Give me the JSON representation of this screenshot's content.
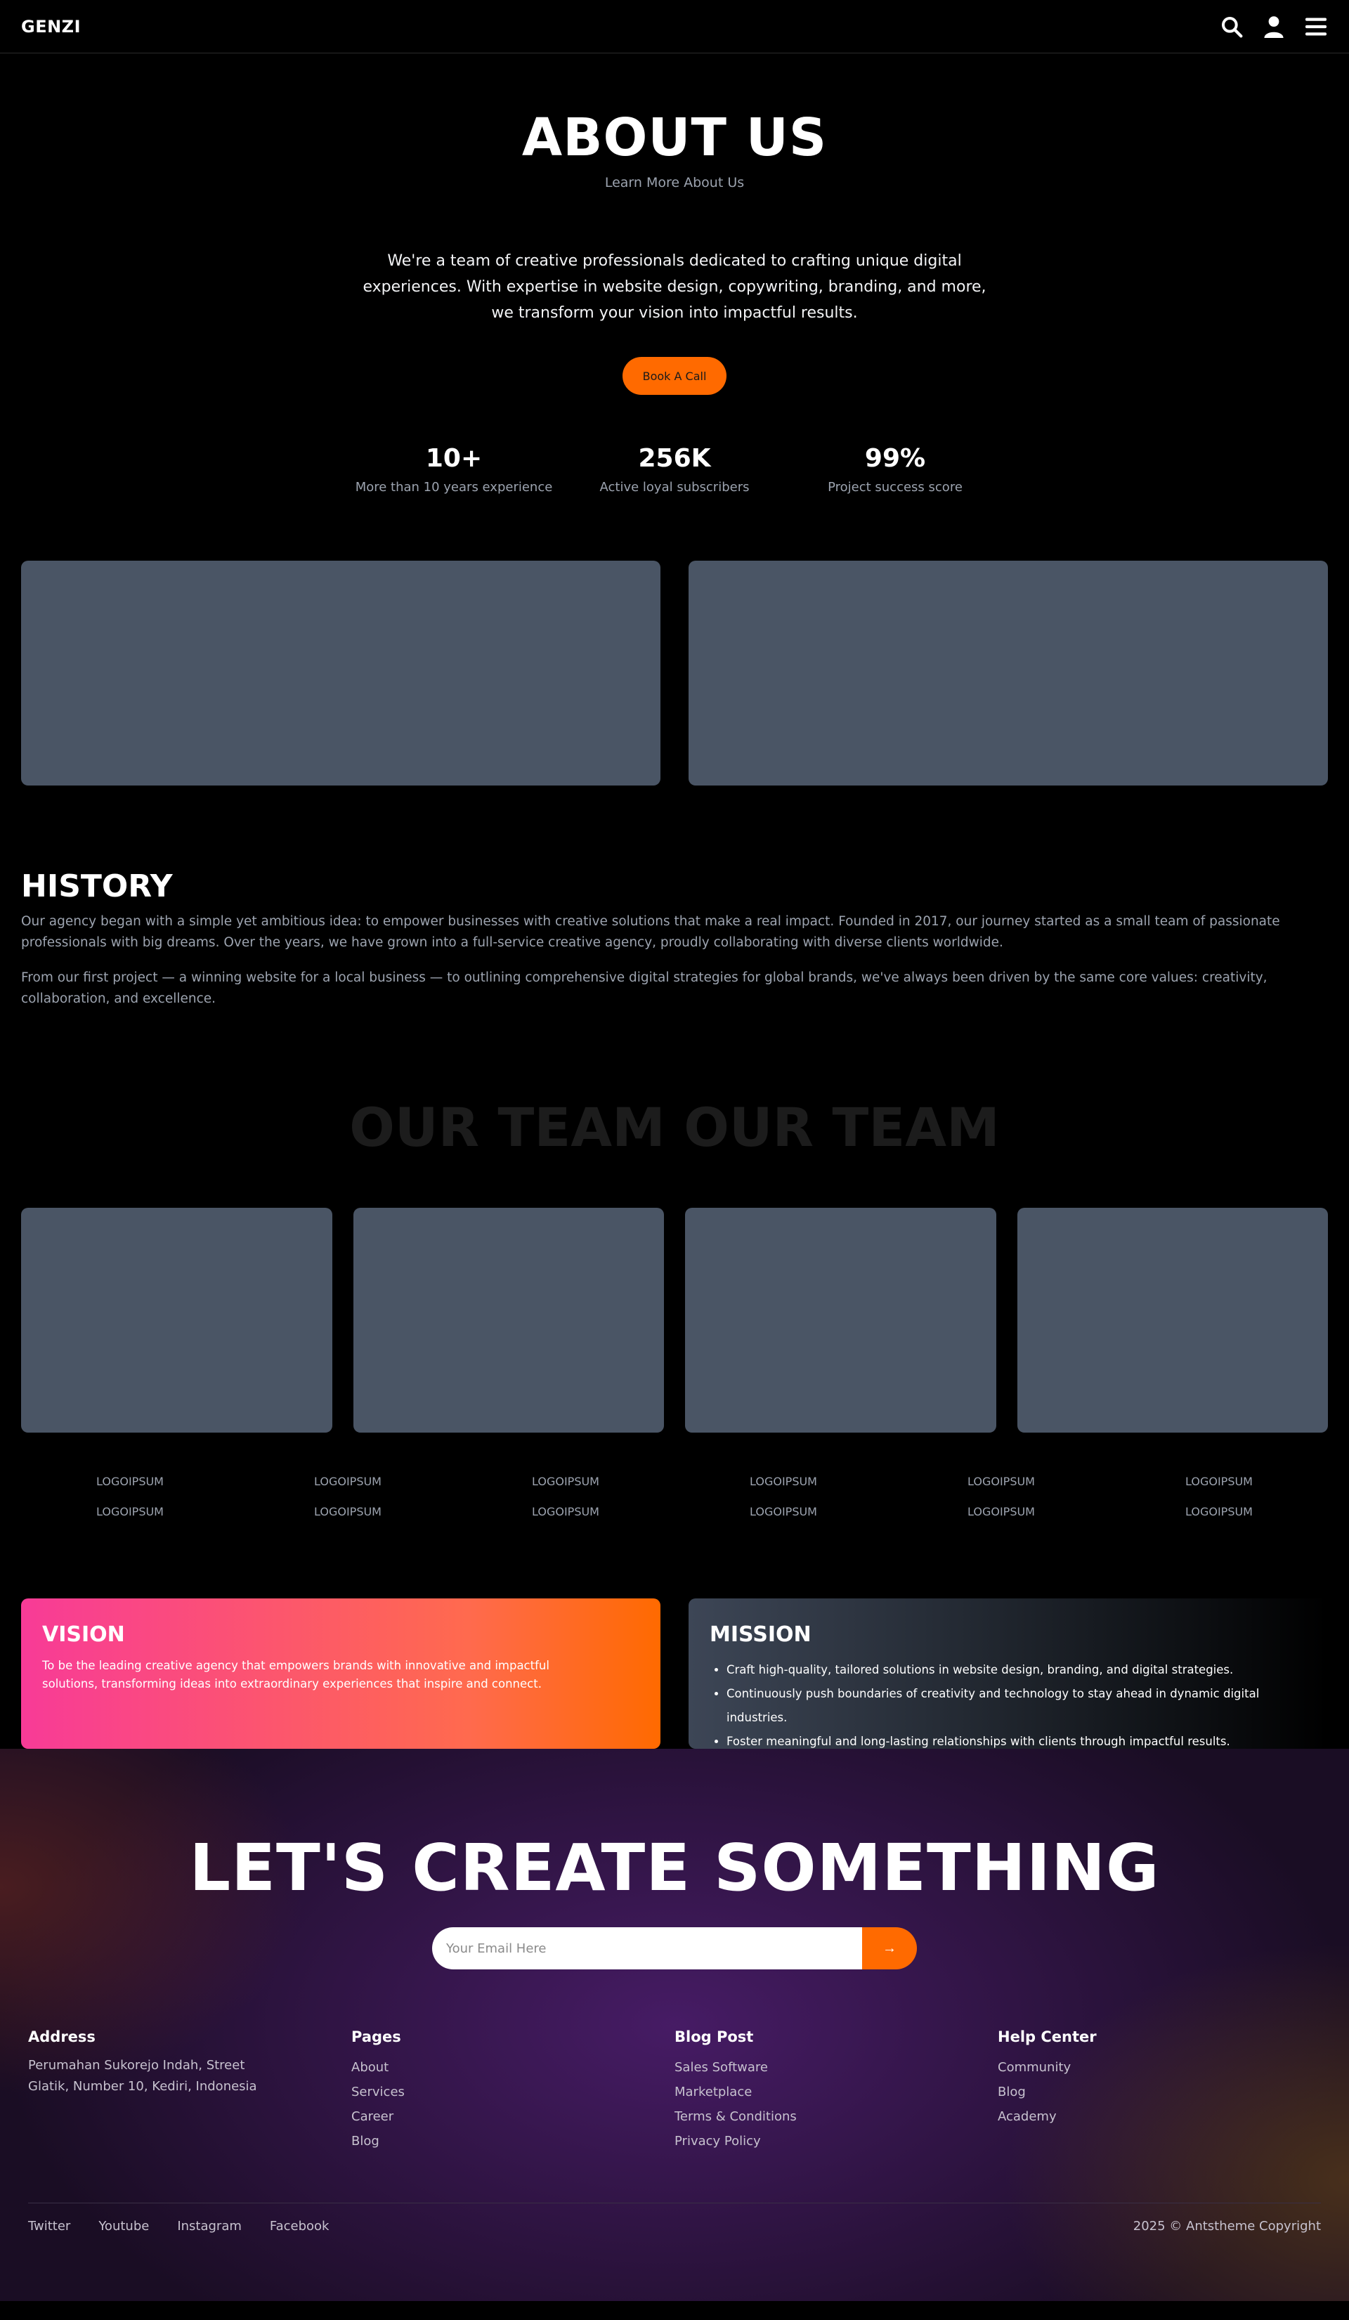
{
  "nav": {
    "logo": "GENZI",
    "icons": [
      "search-icon",
      "user-icon",
      "menu-icon"
    ]
  },
  "hero": {
    "title": "ABOUT US",
    "subtitle": "Learn More About Us",
    "lead": "We're a team of creative professionals dedicated to crafting unique digital experiences. With expertise in website design, copywriting, branding, and more, we transform your vision into impactful results.",
    "cta_label": "Book A Call"
  },
  "stats": [
    {
      "value": "10+",
      "label": "More than 10 years experience"
    },
    {
      "value": "256K",
      "label": "Active loyal subscribers"
    },
    {
      "value": "99%",
      "label": "Project success score"
    }
  ],
  "history": {
    "title": "HISTORY",
    "p1": "Our agency began with a simple yet ambitious idea: to empower businesses with creative solutions that make a real impact. Founded in 2017, our journey started as a small team of passionate professionals with big dreams. Over the years, we have grown into a full-service creative agency, proudly collaborating with diverse clients worldwide.",
    "p2": "From our first project — a winning website for a local business — to outlining comprehensive digital strategies for global brands, we've always been driven by the same core values: creativity, collaboration, and excellence."
  },
  "team": {
    "title": "OUR TEAM OUR TEAM"
  },
  "logos": [
    "LOGOIPSUM",
    "LOGOIPSUM",
    "LOGOIPSUM",
    "LOGOIPSUM",
    "LOGOIPSUM",
    "LOGOIPSUM",
    "LOGOIPSUM",
    "LOGOIPSUM",
    "LOGOIPSUM",
    "LOGOIPSUM",
    "LOGOIPSUM",
    "LOGOIPSUM"
  ],
  "vision": {
    "title": "VISION",
    "text": "To be the leading creative agency that empowers brands with innovative and impactful solutions, transforming ideas into extraordinary experiences that inspire and connect."
  },
  "mission": {
    "title": "MISSION",
    "items": [
      "Craft high-quality, tailored solutions in website design, branding, and digital strategies.",
      "Continuously push boundaries of creativity and technology to stay ahead in dynamic digital industries.",
      "Foster meaningful and long-lasting relationships with clients through impactful results."
    ]
  },
  "footer": {
    "cta": "LET'S CREATE SOMETHING",
    "email_placeholder": "Your Email Here",
    "submit_label": "→",
    "address": {
      "title": "Address",
      "text": "Perumahan Sukorejo Indah, Street Glatik, Number 10, Kediri, Indonesia"
    },
    "pages": {
      "title": "Pages",
      "links": [
        "About",
        "Services",
        "Career",
        "Blog"
      ]
    },
    "blog": {
      "title": "Blog Post",
      "links": [
        "Sales Software",
        "Marketplace",
        "Terms & Conditions",
        "Privacy Policy"
      ]
    },
    "help": {
      "title": "Help Center",
      "links": [
        "Community",
        "Blog",
        "Academy"
      ]
    },
    "social": [
      "Twitter",
      "Youtube",
      "Instagram",
      "Facebook"
    ],
    "copyright": "2025 © Antstheme Copyright"
  },
  "colors": {
    "accent": "#ff6a00",
    "placeholder": "#4a5565",
    "vision_start": "#f83b97"
  }
}
